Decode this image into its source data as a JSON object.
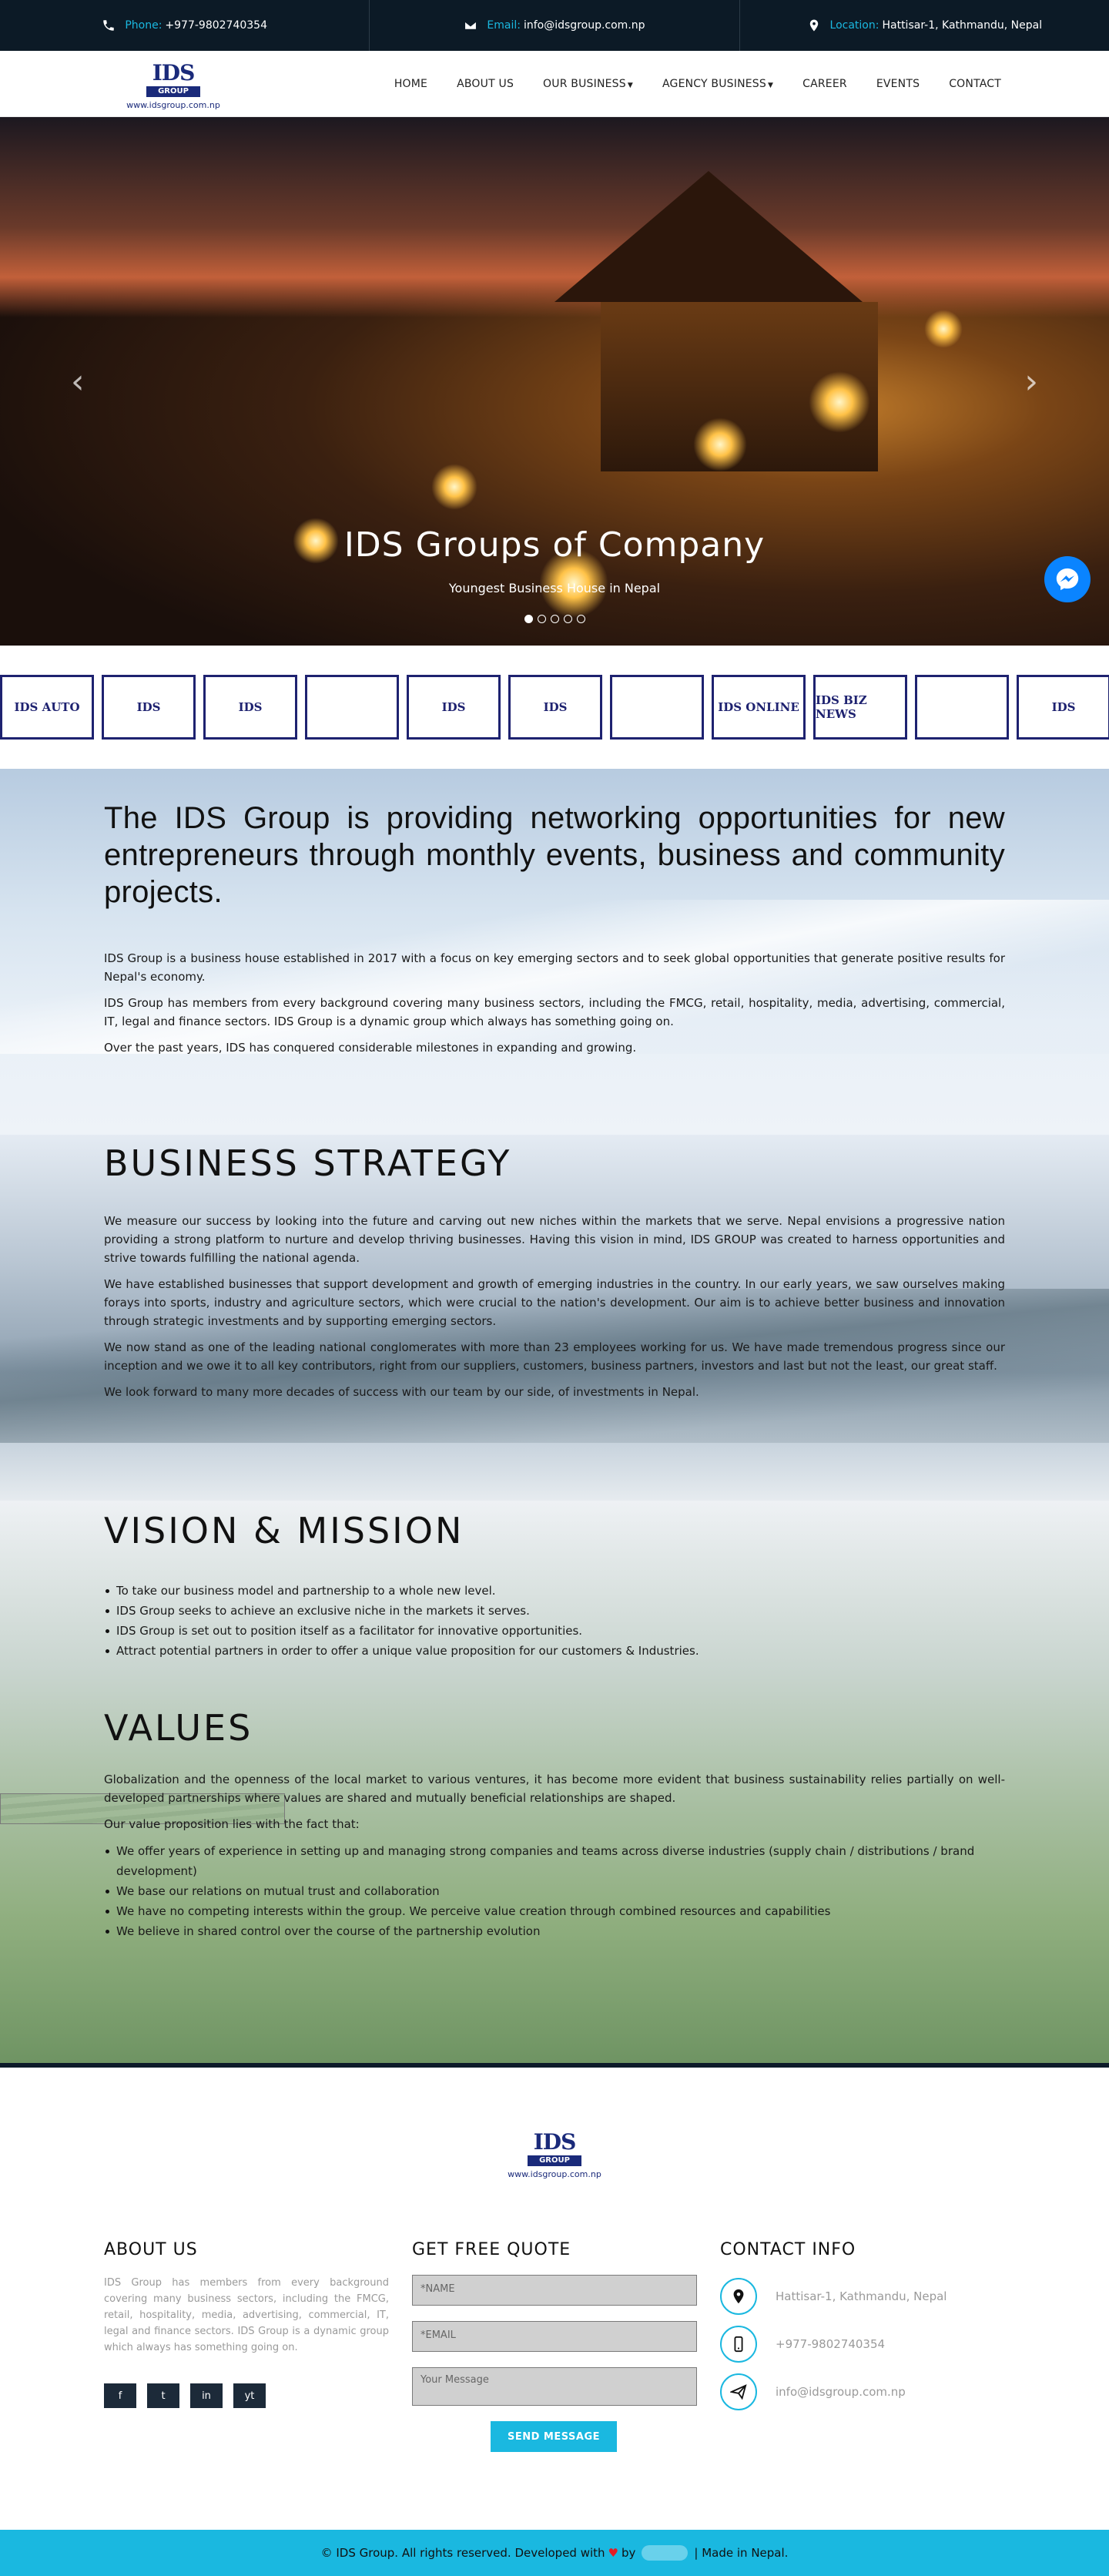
{
  "topbar": {
    "phone_label": "Phone:",
    "phone": "+977-9802740354",
    "email_label": "Email:",
    "email": "info@idsgroup.com.np",
    "location_label": "Location:",
    "location": "Hattisar-1, Kathmandu, Nepal"
  },
  "logo": {
    "mark": "IDS",
    "group": "GROUP",
    "url": "www.idsgroup.com.np"
  },
  "nav": {
    "home": "HOME",
    "about": "ABOUT US",
    "business": "OUR BUSINESS",
    "agency": "AGENCY BUSINESS",
    "career": "CAREER",
    "events": "EVENTS",
    "contact": "CONTACT"
  },
  "hero": {
    "title": "IDS Groups of Company",
    "subtitle": "Youngest Business House in Nepal",
    "slide_count": 5,
    "active_slide": 1
  },
  "brands": [
    "IDS AUTO",
    "IDS",
    "IDS",
    "",
    "IDS",
    "IDS",
    "",
    "IDS ONLINE",
    "IDS BIZ NEWS",
    "",
    "IDS"
  ],
  "about": {
    "lead": "The IDS Group is providing networking opportunities for new entrepreneurs through monthly events, business and community projects.",
    "p1": "IDS Group is a business house established in 2017 with a focus on key emerging sectors and to seek global opportunities that generate positive results for Nepal's economy.",
    "p2": "IDS Group has members from every background covering many business sectors, including the FMCG, retail, hospitality, media, advertising, commercial, IT, legal and finance sectors. IDS Group is a dynamic group which always has something going on.",
    "p3": "Over the past years, IDS has conquered considerable milestones in expanding and growing."
  },
  "strategy": {
    "title": "BUSINESS STRATEGY",
    "p1": "We measure our success by looking into the future and carving out new niches within the markets that we serve. Nepal envisions a progressive nation providing a strong platform to nurture and develop thriving businesses. Having this vision in mind, IDS GROUP was created to harness opportunities and strive towards fulfilling the national agenda.",
    "p2": "We have established businesses that support development and growth of emerging industries in the country. In our early years, we saw ourselves making forays into sports, industry and agriculture sectors, which were crucial to the nation's development. Our aim is to achieve better business and innovation through strategic investments and by supporting emerging sectors.",
    "p3": "We now stand as one of the leading national conglomerates with more than 23 employees working for us. We have made tremendous progress since our inception and we owe it to all key contributors, right from our suppliers, customers, business partners, investors and last but not the least, our great staff.",
    "p4": "We look forward to many more decades of success with our team by our side, of investments in Nepal."
  },
  "vision": {
    "title": "VISION & MISSION",
    "items": [
      "To take our business model and partnership to a whole new level.",
      "IDS Group seeks to achieve an exclusive niche in the markets it serves.",
      "IDS Group is set out to position itself as a facilitator for innovative opportunities.",
      "Attract potential partners in order to offer a unique value proposition for our customers & Industries."
    ]
  },
  "values": {
    "title": "VALUES",
    "p1": "Globalization and the openness of the local market to various ventures, it has become more evident that business sustainability relies partially on well-developed partnerships where values are shared and mutually beneficial relationships are shaped.",
    "p2": "Our value proposition lies with the fact that:",
    "items": [
      "We offer years of experience in setting up and managing strong companies and teams across diverse industries (supply chain / distributions / brand development)",
      "We base our relations on mutual trust and collaboration",
      "We have no competing interests within the group. We perceive value creation through combined resources and capabilities",
      "We believe in shared control over the course of the partnership evolution"
    ]
  },
  "footer": {
    "about_title": "ABOUT US",
    "about_text": "IDS Group has members from every background covering many business sectors, including the FMCG, retail, hospitality, media, advertising, commercial, IT, legal and finance sectors. IDS Group is a dynamic group which always has something going on.",
    "social": {
      "facebook": "f",
      "twitter": "t",
      "linkedin": "in",
      "youtube": "yt"
    },
    "quote_title": "GET FREE QUOTE",
    "name_placeholder": "*NAME",
    "email_placeholder": "*EMAIL",
    "message_placeholder": "Your Message",
    "send": "SEND MESSAGE",
    "contact_title": "CONTACT INFO",
    "address": "Hattisar-1, Kathmandu, Nepal",
    "phone": "+977-9802740354",
    "email": "info@idsgroup.com.np"
  },
  "copyright": {
    "left": "© IDS Group. All rights reserved. Developed with",
    "by": "by",
    "right": "| Made in Nepal."
  },
  "colors": {
    "accent": "#1ab8e0",
    "dark": "#0c1a26",
    "brand": "#1e2270"
  }
}
